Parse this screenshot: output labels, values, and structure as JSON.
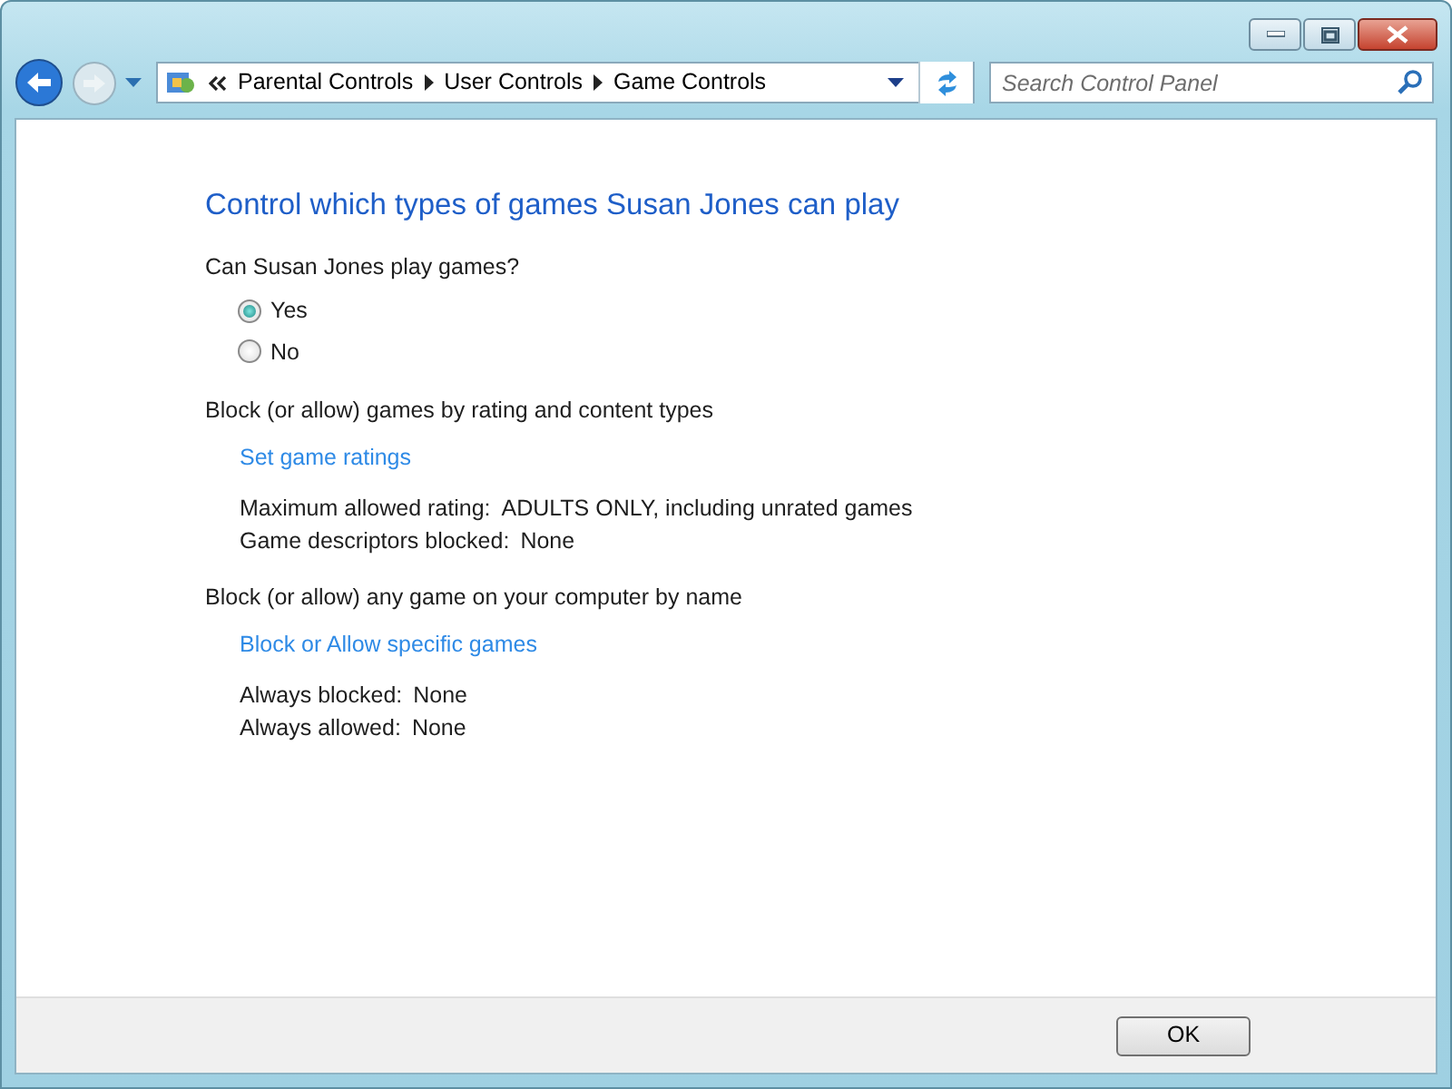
{
  "window": {
    "buttons": [
      {
        "kind": "minimize"
      },
      {
        "kind": "maximize"
      },
      {
        "kind": "close"
      }
    ]
  },
  "address_bar": {
    "crumbs": [
      "Parental Controls",
      "User Controls",
      "Game Controls"
    ]
  },
  "search": {
    "placeholder": "Search Control Panel"
  },
  "title": "Control which types of games Susan Jones can play",
  "question": "Can Susan Jones play games?",
  "options": [
    {
      "label": "Yes",
      "selected": true
    },
    {
      "label": "No",
      "selected": false
    }
  ],
  "sections": [
    {
      "heading": "Block (or allow) games by rating and content types",
      "link": "Set game ratings",
      "details": [
        {
          "label": "Maximum allowed rating:",
          "value": "ADULTS ONLY, including unrated games"
        },
        {
          "label": "Game descriptors blocked:",
          "value": "None"
        }
      ]
    },
    {
      "heading": "Block (or allow) any game on your computer by name",
      "link": "Block or Allow specific games",
      "details": [
        {
          "label": "Always blocked:",
          "value": "None"
        },
        {
          "label": "Always allowed:",
          "value": "None"
        }
      ]
    }
  ],
  "footer": {
    "ok": "OK"
  }
}
